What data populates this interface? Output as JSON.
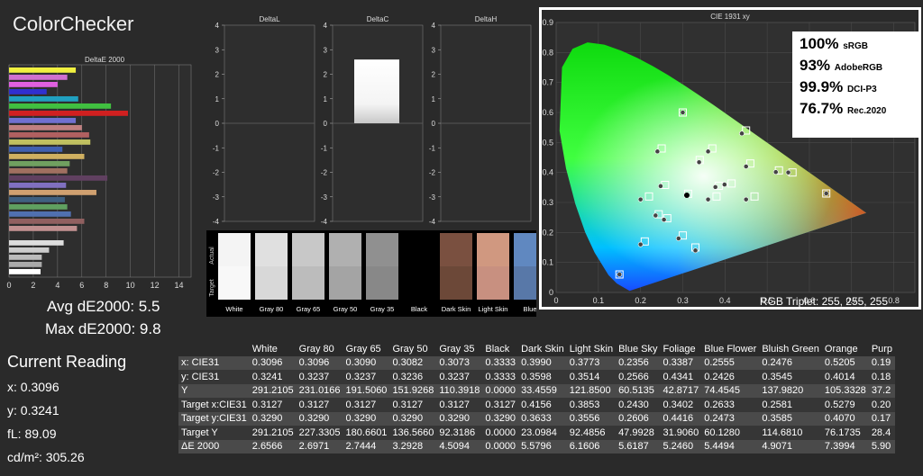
{
  "app_title": "ColorChecker",
  "deltae_chart": {
    "title": "DeltaE 2000",
    "ticks": [
      "0",
      "2",
      "4",
      "6",
      "8",
      "10",
      "12",
      "14"
    ],
    "bars": [
      {
        "value": 5.5,
        "color": "#f0f040"
      },
      {
        "value": 4.8,
        "color": "#d070d0"
      },
      {
        "value": 4.0,
        "color": "#e060e0"
      },
      {
        "value": 3.1,
        "color": "#3030d0"
      },
      {
        "value": 5.7,
        "color": "#20a0c0"
      },
      {
        "value": 8.4,
        "color": "#40c040"
      },
      {
        "value": 9.8,
        "color": "#d02020"
      },
      {
        "value": 5.5,
        "color": "#7070d0"
      },
      {
        "value": 6.0,
        "color": "#c08080"
      },
      {
        "value": 6.6,
        "color": "#b06060"
      },
      {
        "value": 6.7,
        "color": "#c0c060"
      },
      {
        "value": 4.4,
        "color": "#4060b0"
      },
      {
        "value": 6.2,
        "color": "#d0b060"
      },
      {
        "value": 5.0,
        "color": "#70a060"
      },
      {
        "value": 4.8,
        "color": "#a07060"
      },
      {
        "value": 8.1,
        "color": "#604060"
      },
      {
        "value": 4.7,
        "color": "#8070c0"
      },
      {
        "value": 7.2,
        "color": "#d0a070"
      },
      {
        "value": 4.6,
        "color": "#406080"
      },
      {
        "value": 4.8,
        "color": "#60a060"
      },
      {
        "value": 5.1,
        "color": "#5070b0"
      },
      {
        "value": 6.2,
        "color": "#906060"
      },
      {
        "value": 5.6,
        "color": "#c09090"
      },
      {
        "value": 0.0,
        "color": "#000000"
      },
      {
        "value": 4.5,
        "color": "#dddddd"
      },
      {
        "value": 3.3,
        "color": "#cccccc"
      },
      {
        "value": 2.7,
        "color": "#bbbbbb"
      },
      {
        "value": 2.7,
        "color": "#aaaaaa"
      },
      {
        "value": 2.6,
        "color": "#ffffff"
      }
    ]
  },
  "avg_label": "Avg dE2000: 5.5",
  "max_label": "Max dE2000: 9.8",
  "delta_panels": [
    {
      "title": "DeltaL",
      "value": 0
    },
    {
      "title": "DeltaC",
      "value": 2.6
    },
    {
      "title": "DeltaH",
      "value": 0
    }
  ],
  "delta_ticks": [
    "4",
    "3",
    "2",
    "1",
    "0",
    "-1",
    "-2",
    "-3",
    "-4"
  ],
  "swatches": {
    "actual_label": "Actual",
    "target_label": "Target",
    "items": [
      {
        "label": "White",
        "actual": "#f4f4f4",
        "target": "#f8f8f8"
      },
      {
        "label": "Gray 80",
        "actual": "#e0e0e0",
        "target": "#d8d8d8"
      },
      {
        "label": "Gray 65",
        "actual": "#c8c8c8",
        "target": "#bcbcbc"
      },
      {
        "label": "Gray 50",
        "actual": "#b0b0b0",
        "target": "#a4a4a4"
      },
      {
        "label": "Gray 35",
        "actual": "#909090",
        "target": "#888888"
      },
      {
        "label": "Black",
        "actual": "#000000",
        "target": "#000000"
      },
      {
        "label": "Dark Skin",
        "actual": "#7a5040",
        "target": "#6c4838"
      },
      {
        "label": "Light Skin",
        "actual": "#d09880",
        "target": "#c89080"
      },
      {
        "label": "Blue",
        "actual": "#6088c0",
        "target": "#5878a8"
      }
    ]
  },
  "cie": {
    "title": "CIE 1931 xy",
    "x_ticks": [
      "0",
      "0.1",
      "0.2",
      "0.3",
      "0.4",
      "0.5",
      "0.6",
      "0.7",
      "0.8"
    ],
    "y_ticks": [
      "0",
      "0.1",
      "0.2",
      "0.3",
      "0.4",
      "0.5",
      "0.6",
      "0.7",
      "0.8",
      "0.9"
    ],
    "triplet": "RGB Triplet: 255, 255, 255",
    "gamut": [
      {
        "pct": "100%",
        "name": "sRGB"
      },
      {
        "pct": "93%",
        "name": "AdobeRGB"
      },
      {
        "pct": "99.9%",
        "name": "DCI-P3"
      },
      {
        "pct": "76.7%",
        "name": "Rec.2020"
      }
    ]
  },
  "chart_data": [
    {
      "type": "bar",
      "title": "DeltaE 2000",
      "orientation": "horizontal",
      "values": [
        5.5,
        4.8,
        4.0,
        3.1,
        5.7,
        8.4,
        9.8,
        5.5,
        6.0,
        6.6,
        6.7,
        4.4,
        6.2,
        5.0,
        4.8,
        8.1,
        4.7,
        7.2,
        4.6,
        4.8,
        5.1,
        6.2,
        5.6,
        0.0,
        4.5,
        3.3,
        2.7,
        2.7,
        2.6
      ],
      "xlim": [
        0,
        15
      ]
    },
    {
      "type": "scatter",
      "title": "CIE 1931 xy",
      "xlim": [
        0,
        0.8
      ],
      "ylim": [
        0,
        0.9
      ],
      "series": [
        {
          "name": "target",
          "x": [
            0.64,
            0.3,
            0.15,
            0.3127,
            0.4156,
            0.3853,
            0.243,
            0.3402,
            0.2633,
            0.2581,
            0.5279,
            0.21,
            0.46,
            0.33,
            0.3,
            0.22,
            0.47,
            0.25,
            0.38,
            0.56,
            0.45,
            0.37
          ],
          "y": [
            0.33,
            0.6,
            0.06,
            0.329,
            0.3633,
            0.3556,
            0.2606,
            0.4416,
            0.2473,
            0.3585,
            0.407,
            0.17,
            0.43,
            0.15,
            0.19,
            0.32,
            0.32,
            0.48,
            0.32,
            0.4,
            0.54,
            0.48
          ]
        },
        {
          "name": "actual",
          "x": [
            0.64,
            0.3,
            0.15,
            0.3096,
            0.399,
            0.3773,
            0.2356,
            0.3387,
            0.2555,
            0.2476,
            0.5205,
            0.2,
            0.45,
            0.33,
            0.29,
            0.2,
            0.45,
            0.24,
            0.36,
            0.55,
            0.44,
            0.36
          ],
          "y": [
            0.33,
            0.6,
            0.06,
            0.3241,
            0.3598,
            0.3514,
            0.2566,
            0.4341,
            0.2426,
            0.3545,
            0.4014,
            0.16,
            0.42,
            0.14,
            0.18,
            0.31,
            0.31,
            0.47,
            0.31,
            0.4,
            0.53,
            0.47
          ]
        }
      ]
    }
  ],
  "current": {
    "title": "Current Reading",
    "x": "x: 0.3096",
    "y": "y: 0.3241",
    "fl": "fL: 89.09",
    "cd": "cd/m²: 305.26"
  },
  "table": {
    "columns": [
      "",
      "White",
      "Gray 80",
      "Gray 65",
      "Gray 50",
      "Gray 35",
      "Black",
      "Dark Skin",
      "Light Skin",
      "Blue Sky",
      "Foliage",
      "Blue Flower",
      "Bluish Green",
      "Orange",
      "Purp"
    ],
    "rows": [
      [
        "x: CIE31",
        "0.3096",
        "0.3096",
        "0.3090",
        "0.3082",
        "0.3073",
        "0.3333",
        "0.3990",
        "0.3773",
        "0.2356",
        "0.3387",
        "0.2555",
        "0.2476",
        "0.5205",
        "0.19"
      ],
      [
        "y: CIE31",
        "0.3241",
        "0.3237",
        "0.3237",
        "0.3236",
        "0.3237",
        "0.3333",
        "0.3598",
        "0.3514",
        "0.2566",
        "0.4341",
        "0.2426",
        "0.3545",
        "0.4014",
        "0.18"
      ],
      [
        "Y",
        "291.2105",
        "231.0166",
        "191.5060",
        "151.9268",
        "110.3918",
        "0.0000",
        "33.4559",
        "121.8500",
        "60.5135",
        "42.8717",
        "74.4545",
        "137.9820",
        "105.3328",
        "37.2"
      ],
      [
        "Target x:CIE31",
        "0.3127",
        "0.3127",
        "0.3127",
        "0.3127",
        "0.3127",
        "0.3127",
        "0.4156",
        "0.3853",
        "0.2430",
        "0.3402",
        "0.2633",
        "0.2581",
        "0.5279",
        "0.20"
      ],
      [
        "Target y:CIE31",
        "0.3290",
        "0.3290",
        "0.3290",
        "0.3290",
        "0.3290",
        "0.3290",
        "0.3633",
        "0.3556",
        "0.2606",
        "0.4416",
        "0.2473",
        "0.3585",
        "0.4070",
        "0.17"
      ],
      [
        "Target Y",
        "291.2105",
        "227.3305",
        "180.6601",
        "136.5660",
        "92.3186",
        "0.0000",
        "23.0984",
        "92.4856",
        "47.9928",
        "31.9060",
        "60.1280",
        "114.6810",
        "76.1735",
        "28.4"
      ],
      [
        "ΔE 2000",
        "2.6566",
        "2.6971",
        "2.7444",
        "3.2928",
        "4.5094",
        "0.0000",
        "5.5796",
        "6.1606",
        "5.6187",
        "5.2460",
        "5.4494",
        "4.9071",
        "7.3994",
        "5.90"
      ]
    ]
  }
}
